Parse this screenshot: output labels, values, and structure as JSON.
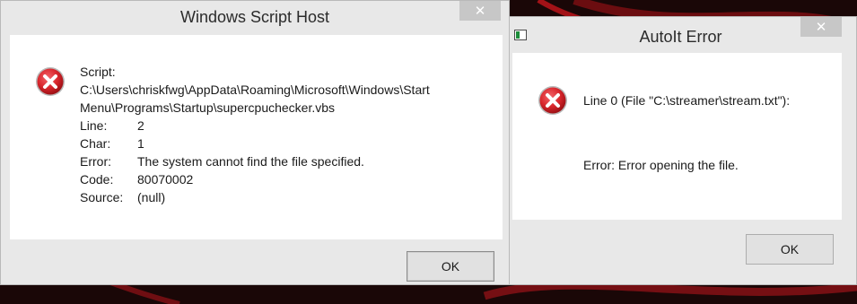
{
  "wsh_dialog": {
    "title": "Windows Script Host",
    "close_glyph": "✕",
    "icon": "error-icon",
    "script_label": "Script:",
    "script_path_line1": "C:\\Users\\chriskfwg\\AppData\\Roaming\\Microsoft\\Windows\\Start",
    "script_path_line2": "Menu\\Programs\\Startup\\supercpuchecker.vbs",
    "fields": [
      {
        "label": "Line:",
        "value": "2"
      },
      {
        "label": "Char:",
        "value": "1"
      },
      {
        "label": "Error:",
        "value": "The system cannot find the file specified."
      },
      {
        "label": "Code:",
        "value": "80070002"
      },
      {
        "label": "Source:",
        "value": "(null)"
      }
    ],
    "ok_label": "OK"
  },
  "autoit_dialog": {
    "title": "AutoIt Error",
    "close_glyph": "✕",
    "app_icon": "autoit-app-icon",
    "icon": "error-icon",
    "line_message": "Line 0  (File \"C:\\streamer\\stream.txt\"):",
    "error_message": "Error: Error opening the file.",
    "ok_label": "OK"
  },
  "colors": {
    "dialog_frame": "#e8e8e8",
    "dialog_content": "#ffffff",
    "close_button": "#c7c7c7",
    "error_red": "#d9262c",
    "desktop_bg": "#1a0707"
  }
}
